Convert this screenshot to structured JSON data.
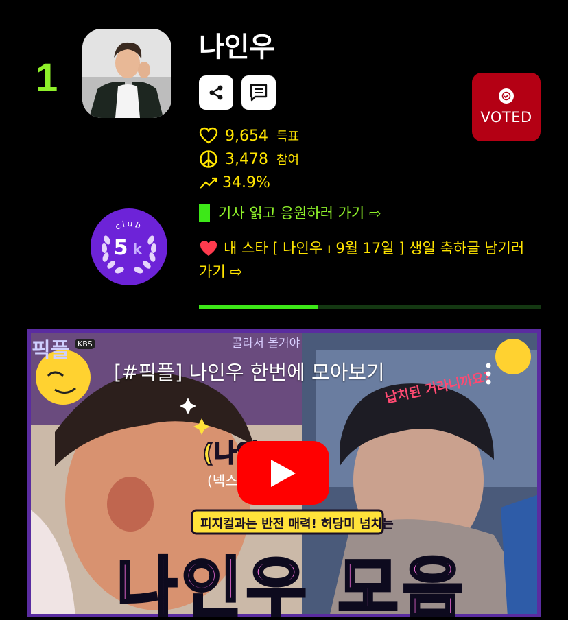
{
  "rank": "1",
  "artist": {
    "name": "나인우"
  },
  "buttons": {
    "share_icon": "share-icon",
    "comment_icon": "comment-icon"
  },
  "voted": {
    "label": "VOTED"
  },
  "stats": {
    "votes": {
      "value": "9,654",
      "unit": "득표"
    },
    "participants": {
      "value": "3,478",
      "unit": "참여"
    },
    "rate": {
      "value": "34.9%"
    }
  },
  "club": {
    "top_text": "club",
    "badge": "5",
    "suffix": "k"
  },
  "links": {
    "article": "기사 읽고 응원하러 가기 ⇨",
    "birthday_line1": "내 스타 [ 나인우 ı 9월 17일 ] 생일 축하글 남기러",
    "birthday_line2": "가기 ⇨"
  },
  "progress": {
    "fill_fraction": 0.35
  },
  "video": {
    "title": "[#픽플] 나인우 한번에 모아보기",
    "top_caption": "골라서 볼거야",
    "side_caption": "납치된 거라니까요?",
    "mid_caption": "(나인우)",
    "sub_caption": "(넥스",
    "yellow_caption": "피지컬과는 반전 매력! 허당미 넘치는",
    "big_title": "나인우 모음",
    "channel_badge": "KBS",
    "left_tag": "픽플"
  },
  "colors": {
    "rank": "#8ef02a",
    "stat_text": "#ffe400",
    "voted_bg": "#b40014",
    "club_bg": "#6d23d8",
    "progress_fill": "#3de818"
  }
}
